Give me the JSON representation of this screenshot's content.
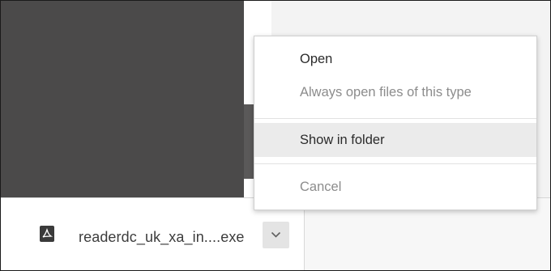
{
  "context_menu": {
    "items": [
      {
        "label": "Open",
        "enabled": true
      },
      {
        "label": "Always open files of this type",
        "enabled": false
      },
      {
        "label": "Show in folder",
        "enabled": true,
        "highlighted": true
      },
      {
        "label": "Cancel",
        "enabled": false
      }
    ]
  },
  "download_bar": {
    "file_name": "readerdc_uk_xa_in....exe",
    "file_icon": "pdf-file-icon",
    "menu_icon": "chevron-down-icon"
  },
  "colors": {
    "page_dark": "#4b4a4a",
    "menu_highlight": "#ebebeb",
    "disabled_text": "#8c8c8c"
  }
}
